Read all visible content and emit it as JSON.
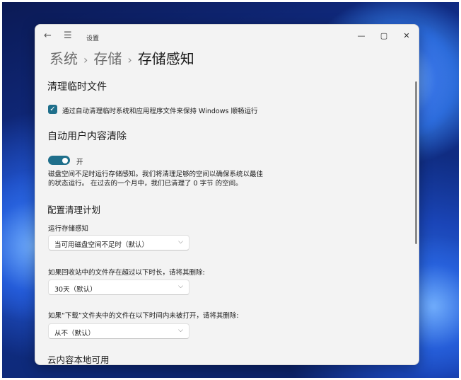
{
  "window": {
    "title": "设置"
  },
  "breadcrumb": {
    "parent1": "系统",
    "parent2": "存储",
    "current": "存储感知",
    "separator": "›"
  },
  "temp_files": {
    "heading": "清理临时文件",
    "checkbox_label": "通过自动清理临时系统和应用程序文件来保持 Windows 顺畅运行",
    "checked": true
  },
  "auto_cleanup": {
    "heading": "自动用户内容清除",
    "toggle_label": "开",
    "toggle_on": true,
    "description_line1": "磁盘空间不足时运行存储感知。我们将清理足够的空间以确保系统以最佳",
    "description_line2": "的状态运行。 在过去的一个月中，我们已清理了 0 字节 的空间。"
  },
  "schedule": {
    "heading": "配置清理计划",
    "run_label": "运行存储感知",
    "run_value": "当可用磁盘空间不足时（默认）",
    "recycle_label": "如果回收站中的文件存在超过以下时长，请将其删除:",
    "recycle_value": "30天（默认）",
    "downloads_label": "如果“下载”文件夹中的文件在以下时间内未被打开，请将其删除:",
    "downloads_value": "从不（默认）"
  },
  "cloud": {
    "heading": "云内容本地可用"
  },
  "icons": {
    "back": "back-arrow-icon",
    "menu": "hamburger-menu-icon",
    "minimize": "minimize-icon",
    "maximize": "maximize-icon",
    "close": "close-icon",
    "check": "check-icon",
    "chevron": "chevron-down-icon"
  },
  "colors": {
    "accent": "#1f6f8b",
    "window_bg": "#f3f3f3",
    "text": "#1b1b1b"
  }
}
